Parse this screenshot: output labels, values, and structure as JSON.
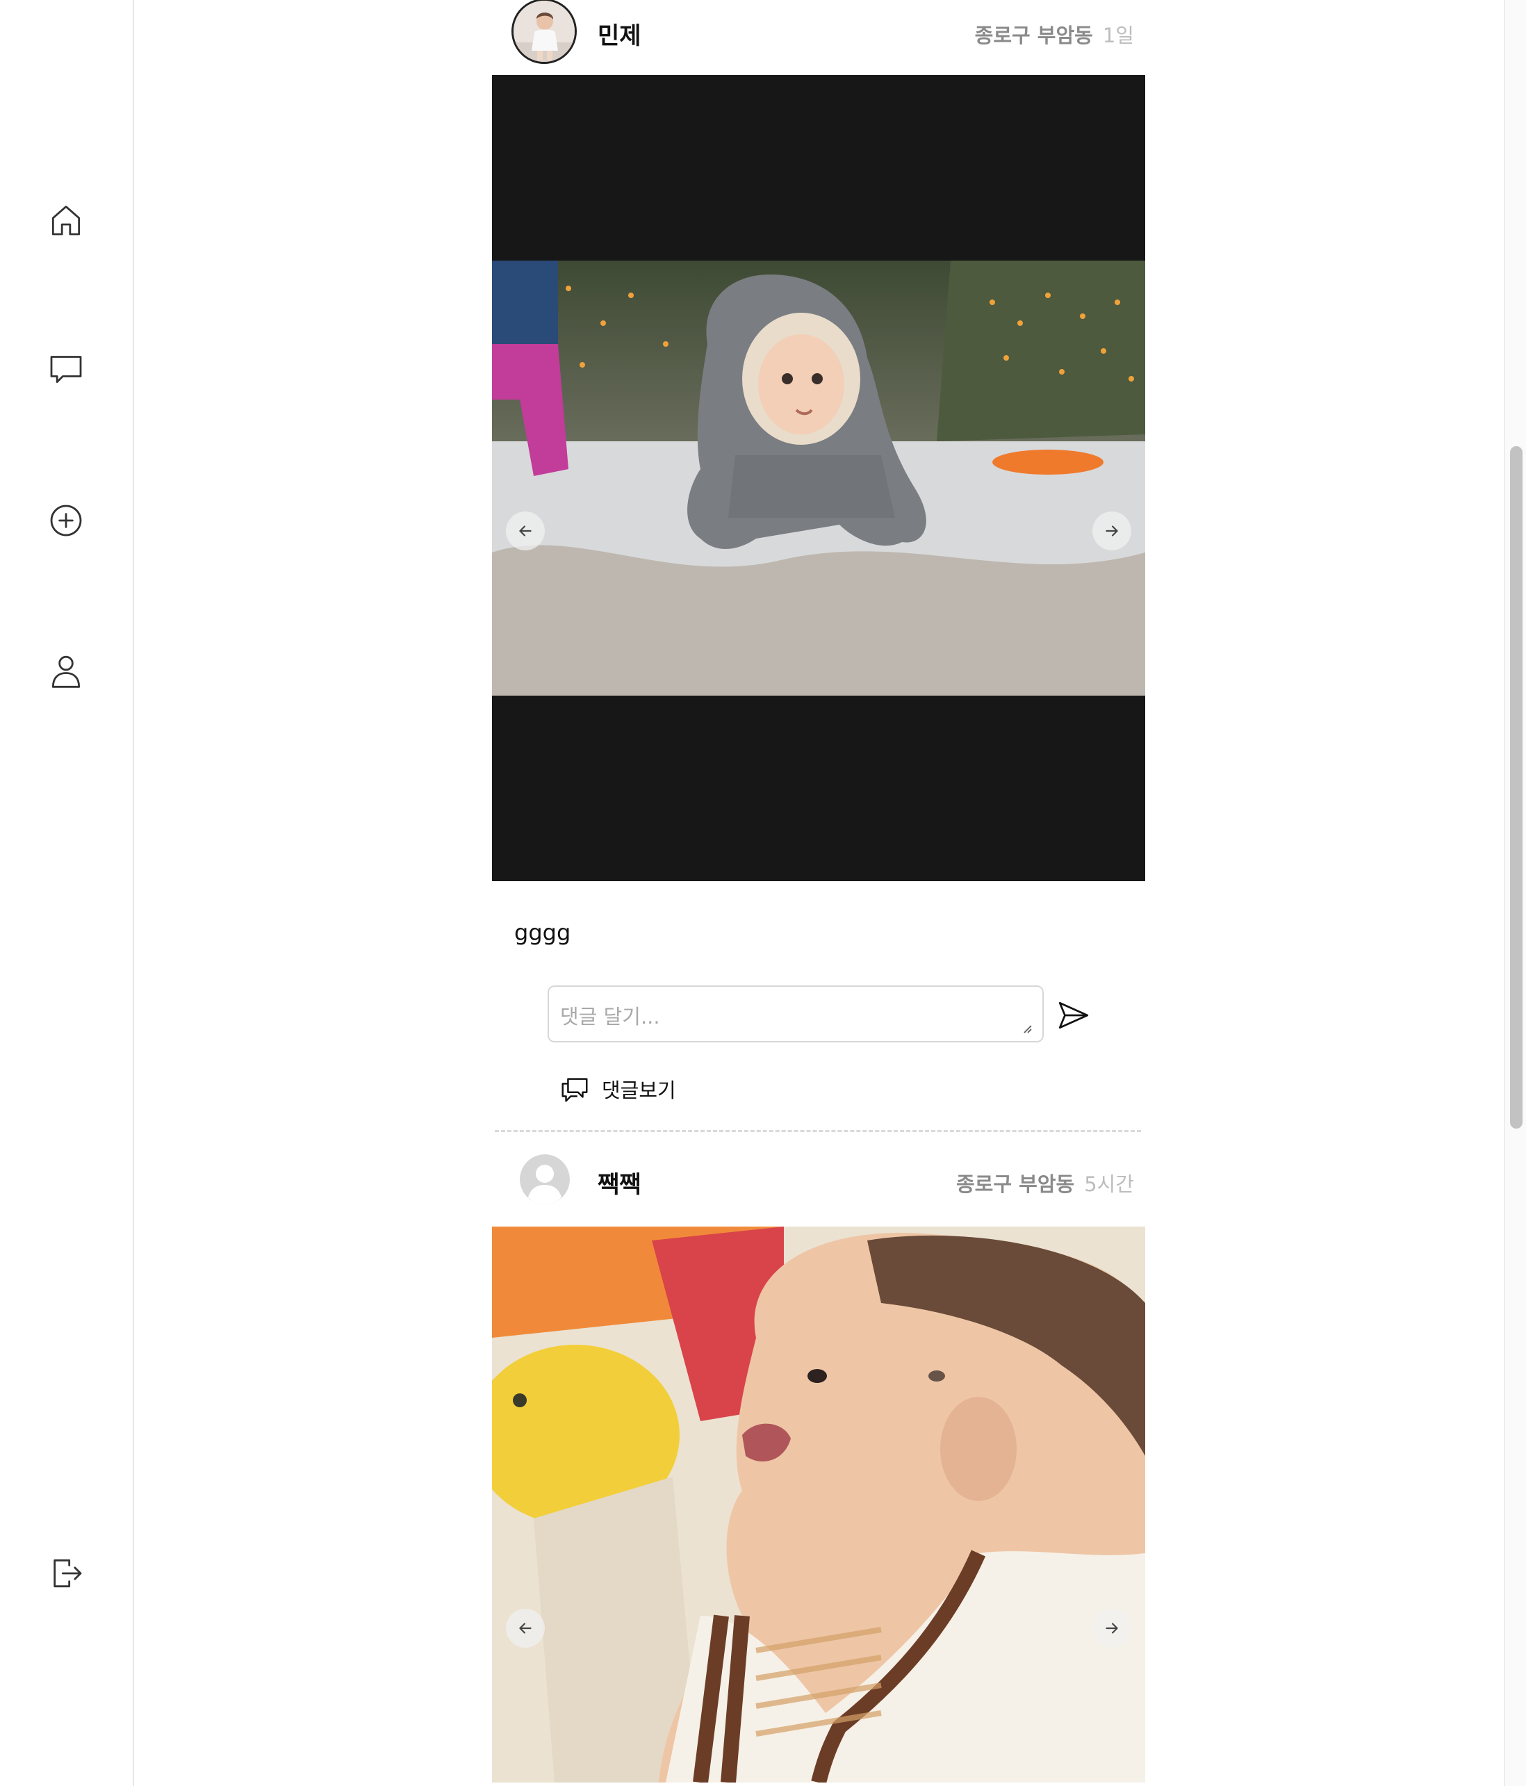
{
  "sidebar": {
    "items": [
      {
        "icon": "home-icon"
      },
      {
        "icon": "chat-bubble-icon"
      },
      {
        "icon": "plus-circle-icon"
      },
      {
        "icon": "user-icon"
      }
    ],
    "logout_icon": "logout-icon"
  },
  "posts": [
    {
      "username": "민제",
      "location": "종로구 부암동",
      "time": "1일",
      "caption": "gggg",
      "comment_placeholder": "댓글 달기...",
      "view_comments_label": "댓글보기",
      "image_description_icon": "baby-in-snow-photo"
    },
    {
      "username": "짹짹",
      "location": "종로구 부암동",
      "time": "5시간",
      "image_description_icon": "smiling-baby-photo"
    }
  ]
}
